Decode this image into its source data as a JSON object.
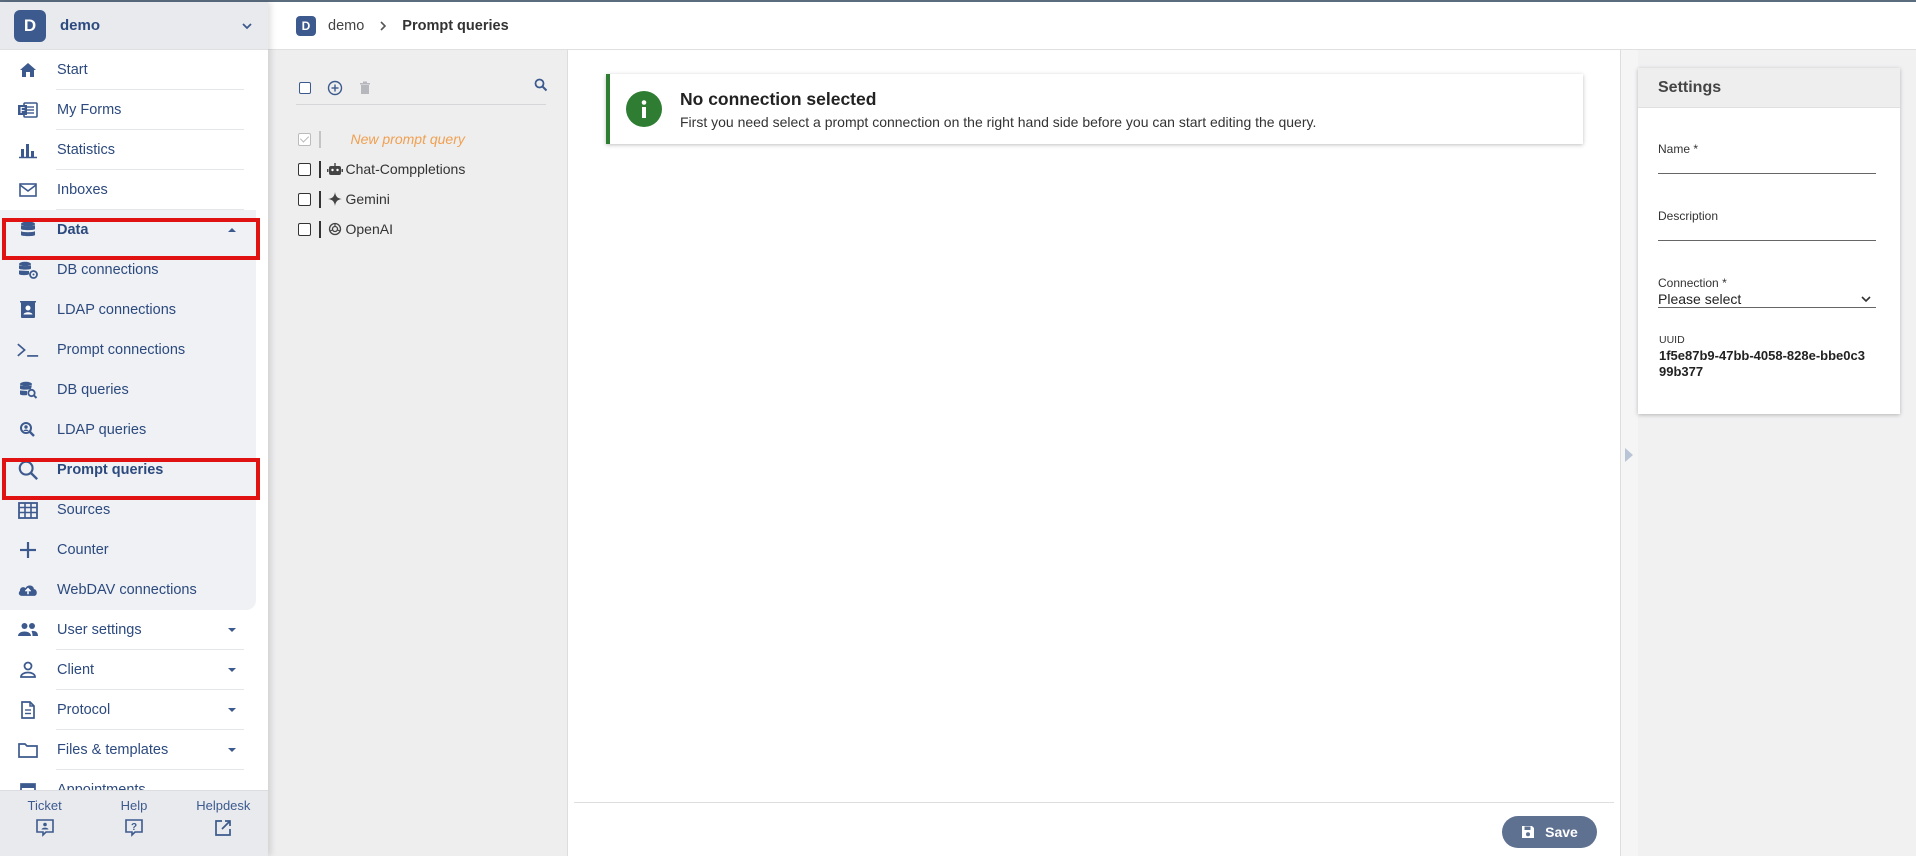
{
  "sidebar": {
    "tenant_initial": "D",
    "tenant_name": "demo",
    "items": [
      {
        "label": "Start"
      },
      {
        "label": "My Forms"
      },
      {
        "label": "Statistics"
      },
      {
        "label": "Inboxes"
      },
      {
        "label": "Data"
      },
      {
        "label": "DB connections"
      },
      {
        "label": "LDAP connections"
      },
      {
        "label": "Prompt connections"
      },
      {
        "label": "DB queries"
      },
      {
        "label": "LDAP queries"
      },
      {
        "label": "Prompt queries"
      },
      {
        "label": "Sources"
      },
      {
        "label": "Counter"
      },
      {
        "label": "WebDAV connections"
      },
      {
        "label": "User settings"
      },
      {
        "label": "Client"
      },
      {
        "label": "Protocol"
      },
      {
        "label": "Files & templates"
      },
      {
        "label": "Appointments"
      }
    ],
    "footer": {
      "ticket": "Ticket",
      "help": "Help",
      "helpdesk": "Helpdesk"
    }
  },
  "breadcrumb": {
    "tenant_initial": "D",
    "root": "demo",
    "current": "Prompt queries"
  },
  "tree": {
    "new_item": "New prompt query",
    "items": [
      {
        "label": "Chat-Comppletions",
        "icon": "robot-icon"
      },
      {
        "label": "Gemini",
        "icon": "sparkle-icon"
      },
      {
        "label": "OpenAI",
        "icon": "openai-icon"
      }
    ]
  },
  "alert": {
    "title": "No connection selected",
    "message": "First you need select a prompt connection on the right hand side before you can start editing the query.",
    "color": "#2e7d32"
  },
  "actions": {
    "save": "Save"
  },
  "settings": {
    "title": "Settings",
    "name_label": "Name",
    "description_label": "Description",
    "connection_label": "Connection",
    "connection_value": "Please select",
    "required_mark": "*",
    "uuid_label": "UUID",
    "uuid_value": "1f5e87b9-47bb-4058-828e-bbe0c399b377"
  },
  "colors": {
    "brand": "#3d5a8e",
    "highlight": "#e01212",
    "save_button": "#5f7191",
    "new_item": "#f0a050"
  }
}
